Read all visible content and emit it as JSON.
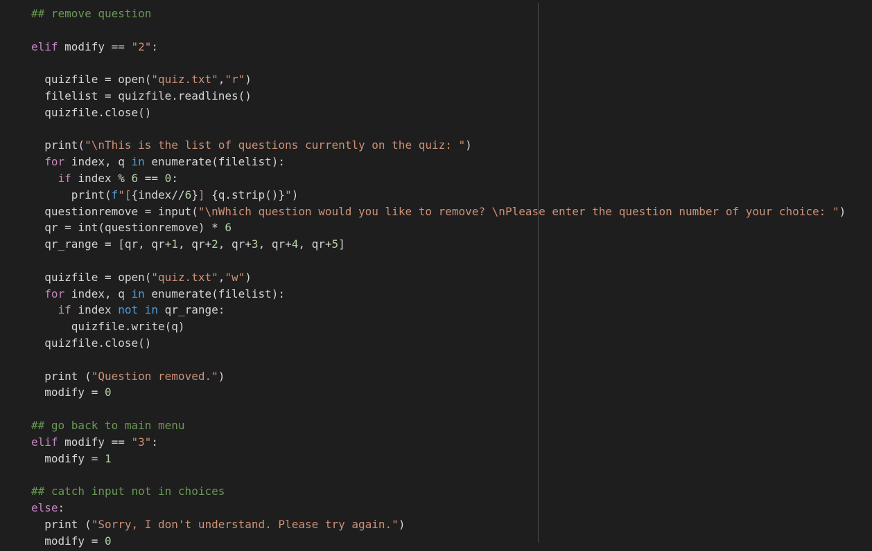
{
  "editor": {
    "theme": {
      "background": "#1e1e1e",
      "ruler": "#4a4a4a",
      "comment": "#6a9955",
      "keyword_control": "#c586c0",
      "keyword": "#569cd6",
      "string": "#ce9178",
      "number": "#b5cea8",
      "text": "#d4d4d4"
    },
    "lines": [
      [
        {
          "t": "## remove question",
          "c": "cmt"
        }
      ],
      [],
      [
        {
          "t": "elif",
          "c": "kw"
        },
        {
          "t": " modify == ",
          "c": "pl"
        },
        {
          "t": "\"2\"",
          "c": "str"
        },
        {
          "t": ":",
          "c": "pl"
        }
      ],
      [],
      [
        {
          "t": "  quizfile = open(",
          "c": "pl"
        },
        {
          "t": "\"quiz.txt\"",
          "c": "str"
        },
        {
          "t": ",",
          "c": "pl"
        },
        {
          "t": "\"r\"",
          "c": "str"
        },
        {
          "t": ")",
          "c": "pl"
        }
      ],
      [
        {
          "t": "  filelist = quizfile.readlines()",
          "c": "pl"
        }
      ],
      [
        {
          "t": "  quizfile.close()",
          "c": "pl"
        }
      ],
      [],
      [
        {
          "t": "  print(",
          "c": "pl"
        },
        {
          "t": "\"\\nThis is the list of questions currently on the quiz: \"",
          "c": "str"
        },
        {
          "t": ")",
          "c": "pl"
        }
      ],
      [
        {
          "t": "  ",
          "c": "pl"
        },
        {
          "t": "for",
          "c": "kw"
        },
        {
          "t": " index, q ",
          "c": "pl"
        },
        {
          "t": "in",
          "c": "kw2"
        },
        {
          "t": " enumerate(filelist):",
          "c": "pl"
        }
      ],
      [
        {
          "t": "    ",
          "c": "pl"
        },
        {
          "t": "if",
          "c": "kw"
        },
        {
          "t": " index % ",
          "c": "pl"
        },
        {
          "t": "6",
          "c": "num"
        },
        {
          "t": " == ",
          "c": "pl"
        },
        {
          "t": "0",
          "c": "num"
        },
        {
          "t": ":",
          "c": "pl"
        }
      ],
      [
        {
          "t": "      print(",
          "c": "pl"
        },
        {
          "t": "f",
          "c": "kw2"
        },
        {
          "t": "\"[",
          "c": "str"
        },
        {
          "t": "{index//",
          "c": "pl"
        },
        {
          "t": "6",
          "c": "num"
        },
        {
          "t": "}",
          "c": "pl"
        },
        {
          "t": "] ",
          "c": "str"
        },
        {
          "t": "{q.strip()}",
          "c": "pl"
        },
        {
          "t": "\"",
          "c": "str"
        },
        {
          "t": ")",
          "c": "pl"
        }
      ],
      [
        {
          "t": "  questionremove = input(",
          "c": "pl"
        },
        {
          "t": "\"\\nWhich question would you like to remove? \\nPlease enter the question number of your choice: \"",
          "c": "str"
        },
        {
          "t": ")",
          "c": "pl"
        }
      ],
      [
        {
          "t": "  qr = int(questionremove) * ",
          "c": "pl"
        },
        {
          "t": "6",
          "c": "num"
        }
      ],
      [
        {
          "t": "  qr_range = [qr, qr+",
          "c": "pl"
        },
        {
          "t": "1",
          "c": "num"
        },
        {
          "t": ", qr+",
          "c": "pl"
        },
        {
          "t": "2",
          "c": "num"
        },
        {
          "t": ", qr+",
          "c": "pl"
        },
        {
          "t": "3",
          "c": "num"
        },
        {
          "t": ", qr+",
          "c": "pl"
        },
        {
          "t": "4",
          "c": "num"
        },
        {
          "t": ", qr+",
          "c": "pl"
        },
        {
          "t": "5",
          "c": "num"
        },
        {
          "t": "]",
          "c": "pl"
        }
      ],
      [],
      [
        {
          "t": "  quizfile = open(",
          "c": "pl"
        },
        {
          "t": "\"quiz.txt\"",
          "c": "str"
        },
        {
          "t": ",",
          "c": "pl"
        },
        {
          "t": "\"w\"",
          "c": "str"
        },
        {
          "t": ")",
          "c": "pl"
        }
      ],
      [
        {
          "t": "  ",
          "c": "pl"
        },
        {
          "t": "for",
          "c": "kw"
        },
        {
          "t": " index, q ",
          "c": "pl"
        },
        {
          "t": "in",
          "c": "kw2"
        },
        {
          "t": " enumerate(filelist):",
          "c": "pl"
        }
      ],
      [
        {
          "t": "    ",
          "c": "pl"
        },
        {
          "t": "if",
          "c": "kw"
        },
        {
          "t": " index ",
          "c": "pl"
        },
        {
          "t": "not",
          "c": "kw2"
        },
        {
          "t": " ",
          "c": "pl"
        },
        {
          "t": "in",
          "c": "kw2"
        },
        {
          "t": " qr_range:",
          "c": "pl"
        }
      ],
      [
        {
          "t": "      quizfile.write(q)",
          "c": "pl"
        }
      ],
      [
        {
          "t": "  quizfile.close()",
          "c": "pl"
        }
      ],
      [],
      [
        {
          "t": "  print (",
          "c": "pl"
        },
        {
          "t": "\"Question removed.\"",
          "c": "str"
        },
        {
          "t": ")",
          "c": "pl"
        }
      ],
      [
        {
          "t": "  modify = ",
          "c": "pl"
        },
        {
          "t": "0",
          "c": "num"
        }
      ],
      [],
      [
        {
          "t": "## go back to main menu",
          "c": "cmt"
        }
      ],
      [
        {
          "t": "elif",
          "c": "kw"
        },
        {
          "t": " modify == ",
          "c": "pl"
        },
        {
          "t": "\"3\"",
          "c": "str"
        },
        {
          "t": ":",
          "c": "pl"
        }
      ],
      [
        {
          "t": "  modify = ",
          "c": "pl"
        },
        {
          "t": "1",
          "c": "num"
        }
      ],
      [],
      [
        {
          "t": "## catch input not in choices",
          "c": "cmt"
        }
      ],
      [
        {
          "t": "else",
          "c": "kw"
        },
        {
          "t": ":",
          "c": "pl"
        }
      ],
      [
        {
          "t": "  print (",
          "c": "pl"
        },
        {
          "t": "\"Sorry, I don't understand. Please try again.\"",
          "c": "str"
        },
        {
          "t": ")",
          "c": "pl"
        }
      ],
      [
        {
          "t": "  modify = ",
          "c": "pl"
        },
        {
          "t": "0",
          "c": "num"
        }
      ]
    ]
  }
}
